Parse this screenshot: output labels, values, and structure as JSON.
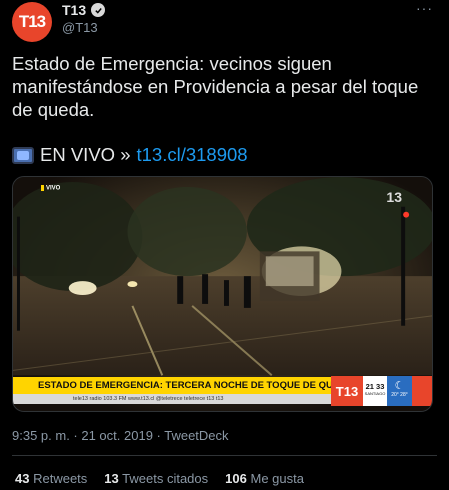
{
  "header": {
    "avatar_label": "T13",
    "display_name": "T13",
    "handle": "@T13",
    "more_label": "···"
  },
  "tweet": {
    "text": "Estado de Emergencia: vecinos siguen manifestándose en Providencia a pesar del toque de queda.",
    "live_prefix": "EN VIVO »",
    "link": "t13.cl/318908",
    "live_icon": "tv-icon"
  },
  "media": {
    "vivo_label": "VIVO",
    "channel_bug": "13",
    "banner": "ESTADO DE EMERGENCIA: TERCERA NOCHE DE TOQUE DE QUEDA",
    "ticker": "tele13 radio 103.3 FM    www.t13.cl    @teletrece    teletrece    t13    t13",
    "logo_label": "T13",
    "clock_time": "21 33",
    "clock_city": "SANTIAGO",
    "temp_range": "20° 28°",
    "weather_icon": "moon-icon"
  },
  "meta": {
    "timestamp": "9:35 p. m. · 21 oct. 2019 · TweetDeck"
  },
  "stats": {
    "retweets_count": "43",
    "retweets_label": "Retweets",
    "quotes_count": "13",
    "quotes_label": "Tweets citados",
    "likes_count": "106",
    "likes_label": "Me gusta"
  },
  "colors": {
    "background": "#000000",
    "link": "#1d9bf0",
    "brand": "#e8452b",
    "banner": "#ffd400"
  }
}
